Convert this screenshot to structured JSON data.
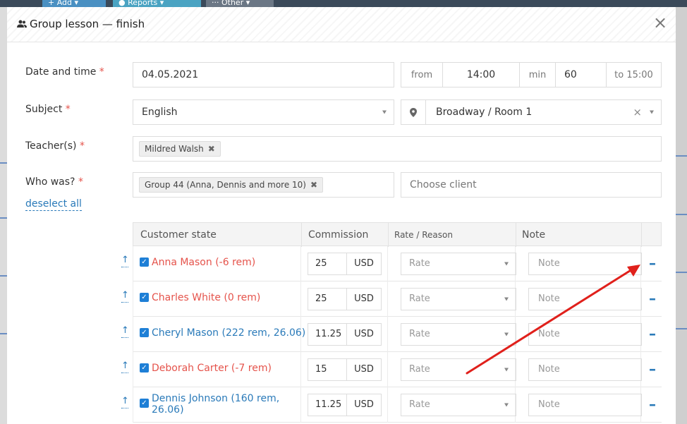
{
  "background": {
    "tabs": [
      "+ Add ▾",
      "● Reports ▾",
      "··· Other ▾"
    ]
  },
  "modal": {
    "title": "Group lesson — finish",
    "close_glyph": "×"
  },
  "form": {
    "date_label": "Date and time",
    "date_value": "04.05.2021",
    "from_label": "from",
    "from_value": "14:00",
    "min_label": "min",
    "min_value": "60",
    "to_label": "to 15:00",
    "subject_label": "Subject",
    "subject_value": "English",
    "location_value": "Broadway / Room 1",
    "location_clear": "×",
    "teacher_label": "Teacher(s)",
    "teacher_tag": "Mildred Walsh",
    "who_label": "Who was?",
    "group_tag": "Group 44 (Anna, Dennis and more 10)",
    "choose_client_placeholder": "Choose client",
    "deselect_all": "deselect all",
    "required_mark": "*",
    "tag_remove": "✖"
  },
  "table": {
    "headers": {
      "customer": "Customer state",
      "commission": "Commission",
      "rate": "Rate / Reason",
      "note": "Note"
    },
    "rows": [
      {
        "name": "Anna Mason (-6 rem)",
        "color": "red",
        "commission": "25",
        "currency": "USD",
        "rate_placeholder": "Rate",
        "note_placeholder": "Note"
      },
      {
        "name": "Charles White (0 rem)",
        "color": "red",
        "commission": "25",
        "currency": "USD",
        "rate_placeholder": "Rate",
        "note_placeholder": "Note"
      },
      {
        "name": "Cheryl Mason (222 rem, 26.06)",
        "color": "blue",
        "commission": "11.25",
        "currency": "USD",
        "rate_placeholder": "Rate",
        "note_placeholder": "Note"
      },
      {
        "name": "Deborah Carter (-7 rem)",
        "color": "red",
        "commission": "15",
        "currency": "USD",
        "rate_placeholder": "Rate",
        "note_placeholder": "Note"
      },
      {
        "name": "Dennis Johnson (160 rem, 26.06)",
        "color": "blue",
        "commission": "11.25",
        "currency": "USD",
        "rate_placeholder": "Rate",
        "note_placeholder": "Note"
      }
    ]
  },
  "colors": {
    "accent": "#2a7ab9",
    "negative": "#e5534b",
    "annotation_arrow": "#e0201b"
  }
}
